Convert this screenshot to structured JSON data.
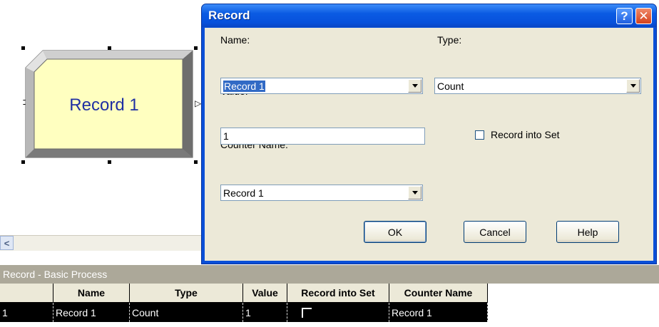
{
  "canvas": {
    "module": {
      "label": "Record 1"
    }
  },
  "dialog": {
    "title": "Record",
    "help_button": "?",
    "close_button": "✕",
    "name_label": "Name:",
    "name_value": "Record 1",
    "type_label": "Type:",
    "type_value": "Count",
    "value_label": "Value:",
    "value_value": "1",
    "record_into_set_label": "Record into Set",
    "record_into_set_checked": false,
    "counter_name_label": "Counter Name:",
    "counter_name_value": "Record 1",
    "ok_label": "OK",
    "cancel_label": "Cancel",
    "help_label": "Help"
  },
  "spreadsheet": {
    "title": "Record - Basic Process",
    "columns": [
      "Name",
      "Type",
      "Value",
      "Record into Set",
      "Counter Name"
    ],
    "rows": [
      {
        "index": "1",
        "name": "Record 1",
        "type": "Count",
        "value": "1",
        "record_into_set": false,
        "counter_name": "Record 1"
      }
    ]
  },
  "icons": {
    "scroll_left": "chevron-left-icon",
    "dropdown": "chevron-down-icon"
  }
}
